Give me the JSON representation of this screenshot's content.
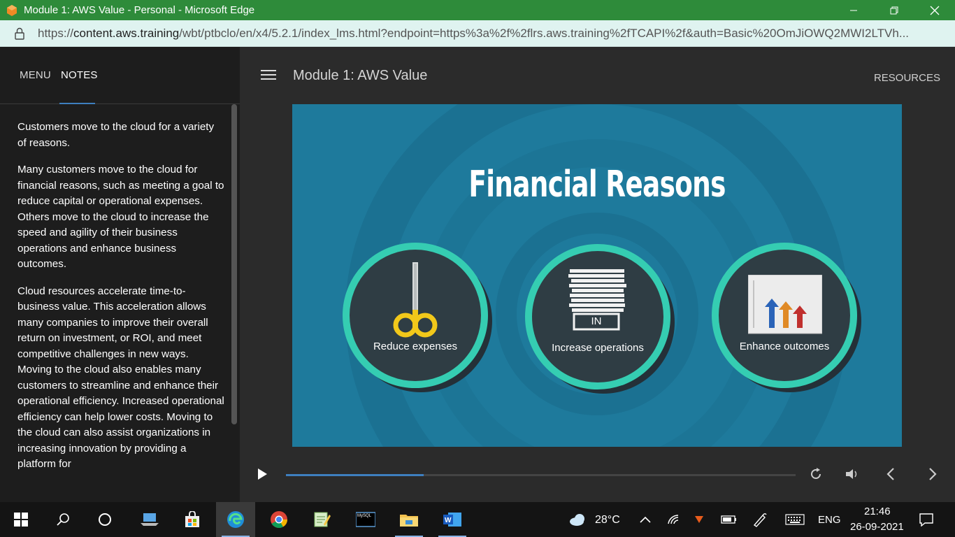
{
  "window": {
    "title": "Module 1: AWS Value - Personal - Microsoft Edge",
    "url_prefix": "https://",
    "url_host": "content.aws.training",
    "url_rest": "/wbt/ptbclo/en/x4/5.2.1/index_lms.html?endpoint=https%3a%2f%2flrs.aws.training%2fTCAPI%2f&auth=Basic%20OmJiOWQ2MWI2LTVh..."
  },
  "sidebar": {
    "tabs": [
      {
        "label": "MENU",
        "active": false
      },
      {
        "label": "NOTES",
        "active": true
      }
    ],
    "notes": [
      "Customers move to the cloud for a variety of reasons.",
      "Many customers move to the cloud for financial reasons, such as meeting a goal to reduce capital or operational expenses. Others move to the cloud to increase the speed and agility of their business operations and enhance business outcomes.",
      "Cloud resources accelerate time-to-business value. This acceleration allows many companies to improve their overall return on investment, or ROI, and meet competitive challenges in new ways. Moving to the cloud also enables many customers to streamline and enhance their operational efficiency. Increased operational efficiency can help lower costs. Moving to the cloud can also assist organizations in increasing innovation by providing a platform for"
    ]
  },
  "header": {
    "module_title": "Module 1: AWS Value",
    "resources_label": "RESOURCES"
  },
  "slide": {
    "title": "Financial Reasons",
    "items": [
      {
        "label": "Reduce expenses",
        "icon": "scissors-icon"
      },
      {
        "label": "Increase operations",
        "icon": "paper-stack-icon",
        "tray_label": "IN"
      },
      {
        "label": "Enhance outcomes",
        "icon": "bar-chart-arrows-icon"
      }
    ]
  },
  "player": {
    "progress": 0.27
  },
  "taskbar": {
    "weather_temp": "28°C",
    "language": "ENG",
    "time": "21:46",
    "date": "26-09-2021",
    "mysql_label": "MySQL"
  },
  "colors": {
    "titlebar": "#2e8b3a",
    "accent": "#3e7fbf",
    "slide_bg": "#1e7a9c",
    "ring": "#35cdb2"
  }
}
